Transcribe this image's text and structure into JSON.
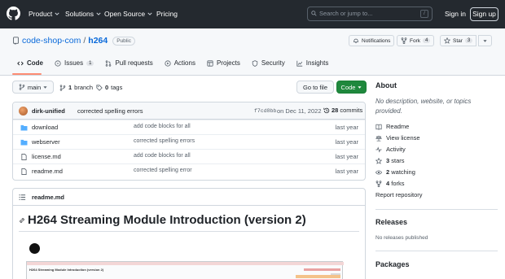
{
  "header": {
    "nav": [
      {
        "label": "Product",
        "has_menu": true
      },
      {
        "label": "Solutions",
        "has_menu": true
      },
      {
        "label": "Open Source",
        "has_menu": true
      },
      {
        "label": "Pricing",
        "has_menu": false
      }
    ],
    "search_placeholder": "Search or jump to...",
    "search_shortcut": "/",
    "sign_in": "Sign in",
    "sign_up": "Sign up"
  },
  "repo": {
    "owner": "code-shop-com",
    "separator": "/",
    "name": "h264",
    "visibility": "Public",
    "notifications_label": "Notifications",
    "fork_label": "Fork",
    "fork_count": "4",
    "star_label": "Star",
    "star_count": "3"
  },
  "tabs": [
    {
      "label": "Code",
      "icon": "code-icon",
      "active": true,
      "count": ""
    },
    {
      "label": "Issues",
      "icon": "issue-icon",
      "active": false,
      "count": "1"
    },
    {
      "label": "Pull requests",
      "icon": "pull-request-icon",
      "active": false,
      "count": ""
    },
    {
      "label": "Actions",
      "icon": "play-icon",
      "active": false,
      "count": ""
    },
    {
      "label": "Projects",
      "icon": "table-icon",
      "active": false,
      "count": ""
    },
    {
      "label": "Security",
      "icon": "shield-icon",
      "active": false,
      "count": ""
    },
    {
      "label": "Insights",
      "icon": "graph-icon",
      "active": false,
      "count": ""
    }
  ],
  "branchbar": {
    "branch": "main",
    "branch_count": "1",
    "branch_label": "branch",
    "tag_count": "0",
    "tag_label": "tags",
    "go_to_file": "Go to file",
    "code_button": "Code"
  },
  "commit": {
    "author": "dirk-unified",
    "message": "corrected spelling errors",
    "sha": "f7cd8bb",
    "date": "on Dec 11, 2022",
    "count": "28",
    "count_label": "commits"
  },
  "files": [
    {
      "type": "dir",
      "name": "download",
      "message": "add code blocks for all",
      "age": "last year"
    },
    {
      "type": "dir",
      "name": "webserver",
      "message": "corrected spelling errors",
      "age": "last year"
    },
    {
      "type": "file",
      "name": "license.md",
      "message": "add code blocks for all",
      "age": "last year"
    },
    {
      "type": "file",
      "name": "readme.md",
      "message": "corrected spelling error",
      "age": "last year"
    }
  ],
  "readme": {
    "filename": "readme.md",
    "heading": "H264 Streaming Module Introduction (version 2)",
    "embedded_caption": "H264 Streaming Module Introduction (version 2)"
  },
  "sidebar": {
    "about_title": "About",
    "description": "No description, website, or topics provided.",
    "items": [
      {
        "icon": "book-icon",
        "text": "Readme",
        "bold": ""
      },
      {
        "icon": "law-icon",
        "text": "View license",
        "bold": ""
      },
      {
        "icon": "pulse-icon",
        "text": "Activity",
        "bold": ""
      },
      {
        "icon": "star-icon",
        "text": "stars",
        "bold": "3"
      },
      {
        "icon": "eye-icon",
        "text": "watching",
        "bold": "2"
      },
      {
        "icon": "fork-icon",
        "text": "forks",
        "bold": "4"
      }
    ],
    "report": "Report repository",
    "releases_title": "Releases",
    "releases_text": "No releases published",
    "packages_title": "Packages"
  },
  "colors": {
    "header_bg": "#24292f",
    "code_button_bg": "#1f883d",
    "link_blue": "#0969da",
    "folder_blue": "#54aeff",
    "tab_underline": "#fd8c73"
  }
}
